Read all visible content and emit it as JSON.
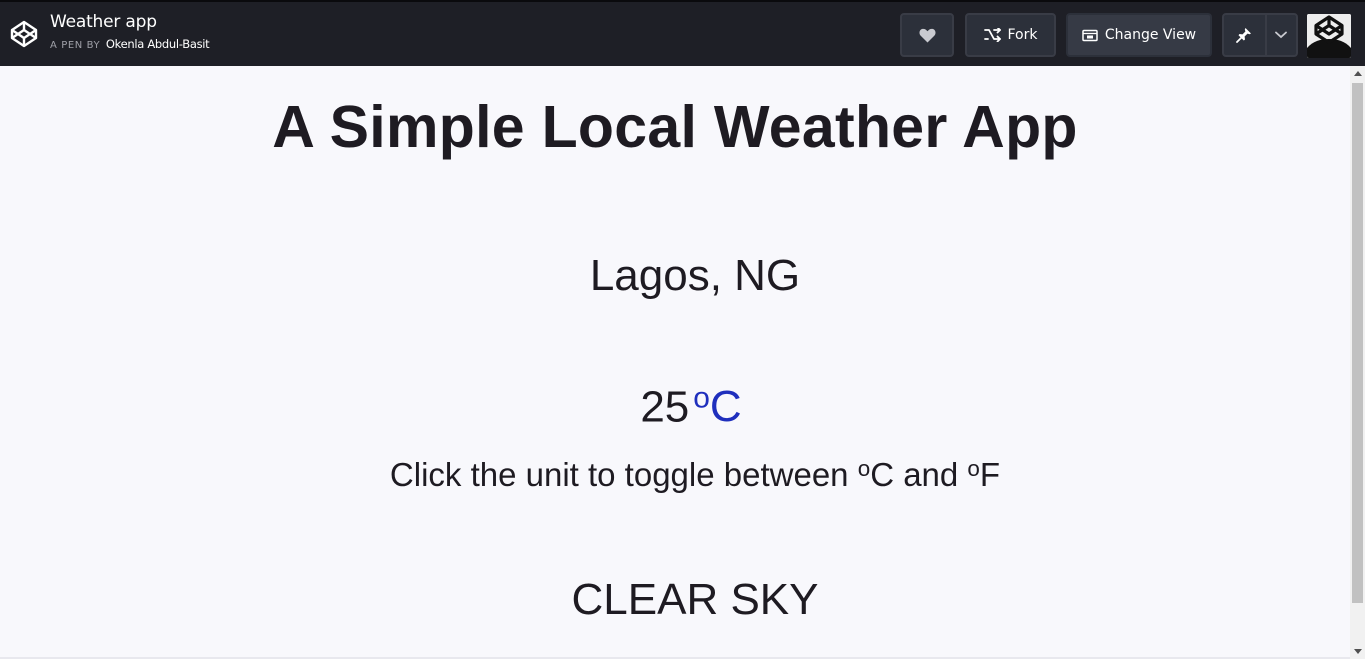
{
  "header": {
    "pen_title": "Weather app",
    "by_label": "A PEN BY",
    "author": "Okenla Abdul-Basit",
    "buttons": {
      "fork": "Fork",
      "change_view": "Change View"
    },
    "icons": {
      "logo": "codepen-logo-icon",
      "heart": "heart-icon",
      "fork": "fork-icon",
      "change_view": "change-view-icon",
      "pin": "pin-icon",
      "chevron": "chevron-down-icon"
    },
    "colors": {
      "bar_bg": "#1e1f26",
      "button_bg": "#2c303a"
    }
  },
  "app": {
    "heading": "A Simple Local Weather App",
    "location": "Lagos, NG",
    "temperature": "25",
    "unit_degree": "o",
    "unit_letter": "C",
    "hint_prefix": "Click the unit to toggle between ",
    "hint_deg1": "o",
    "hint_c": "C and ",
    "hint_deg2": "o",
    "hint_f": "F",
    "description": "CLEAR SKY",
    "colors": {
      "text": "#1e1b22",
      "unit": "#1f2fbd",
      "background": "#f8f8fc"
    }
  }
}
